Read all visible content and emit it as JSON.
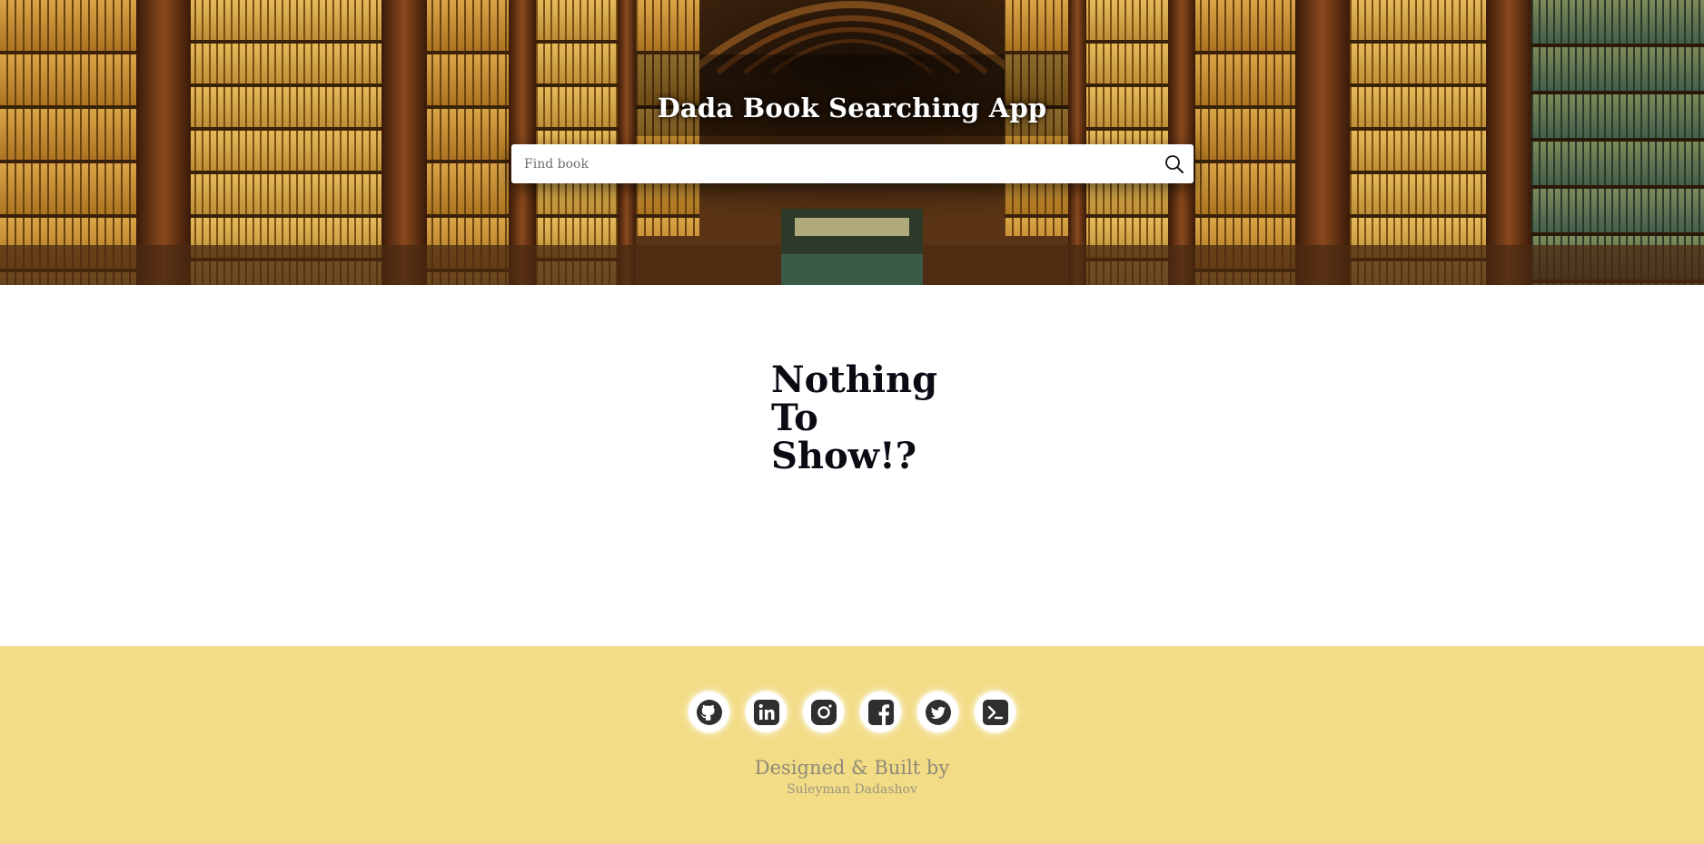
{
  "header": {
    "title": "Dada Book Searching App"
  },
  "search": {
    "placeholder": "Find book",
    "value": "",
    "icon": "search-icon"
  },
  "main": {
    "empty_lines": [
      "Nothing",
      "To",
      "Show!?"
    ]
  },
  "footer": {
    "socials": [
      {
        "name": "github",
        "icon": "github-icon"
      },
      {
        "name": "linkedin",
        "icon": "linkedin-icon"
      },
      {
        "name": "instagram",
        "icon": "instagram-icon"
      },
      {
        "name": "facebook",
        "icon": "facebook-icon"
      },
      {
        "name": "twitter",
        "icon": "twitter-icon"
      },
      {
        "name": "terminal",
        "icon": "terminal-icon"
      }
    ],
    "credit": "Designed & Built by",
    "author": "Suleyman Dadashov"
  },
  "colors": {
    "footer_bg": "#f2dc86",
    "icon_fill": "#2f2f2f",
    "heading_text": "#0b0b14"
  }
}
